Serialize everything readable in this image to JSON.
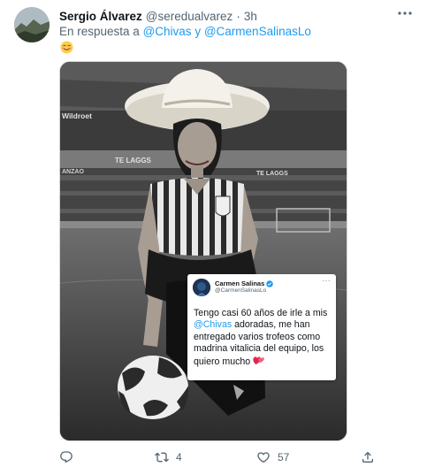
{
  "tweet": {
    "author_name": "Sergio Álvarez",
    "author_handle": "@seredualvarez",
    "separator": "·",
    "time": "3h",
    "reply_prefix": "En respuesta a",
    "reply_mention_1": "@Chivas",
    "reply_conjunction": "y",
    "reply_mention_2": "@CarmenSalinasLo",
    "emoji": "smiling-face-emoji"
  },
  "media": {
    "stadium_signs": [
      "Wildroet",
      "TE LAGGS",
      "TE LAGGS",
      "ANZAO"
    ],
    "embedded_tweet": {
      "name": "Carmen Salinas",
      "handle": "@CarmenSalinasLo",
      "text_before": "Tengo casi 60 años de irle a mis ",
      "mention": "@Chivas",
      "text_after": " adoradas, me han entregado varios trofeos como madrina vitalicia del equipo, los quiero mucho"
    }
  },
  "actions": {
    "reply_count": "",
    "retweet_count": "4",
    "like_count": "57",
    "share_count": ""
  },
  "colors": {
    "accent": "#1d9bf0",
    "secondary_text": "#536471",
    "primary_text": "#0f1419",
    "verified": "#1d9bf0"
  },
  "icons": [
    "more-icon",
    "reply-icon",
    "retweet-icon",
    "like-icon",
    "share-icon",
    "verified-icon",
    "heart-emoji"
  ]
}
